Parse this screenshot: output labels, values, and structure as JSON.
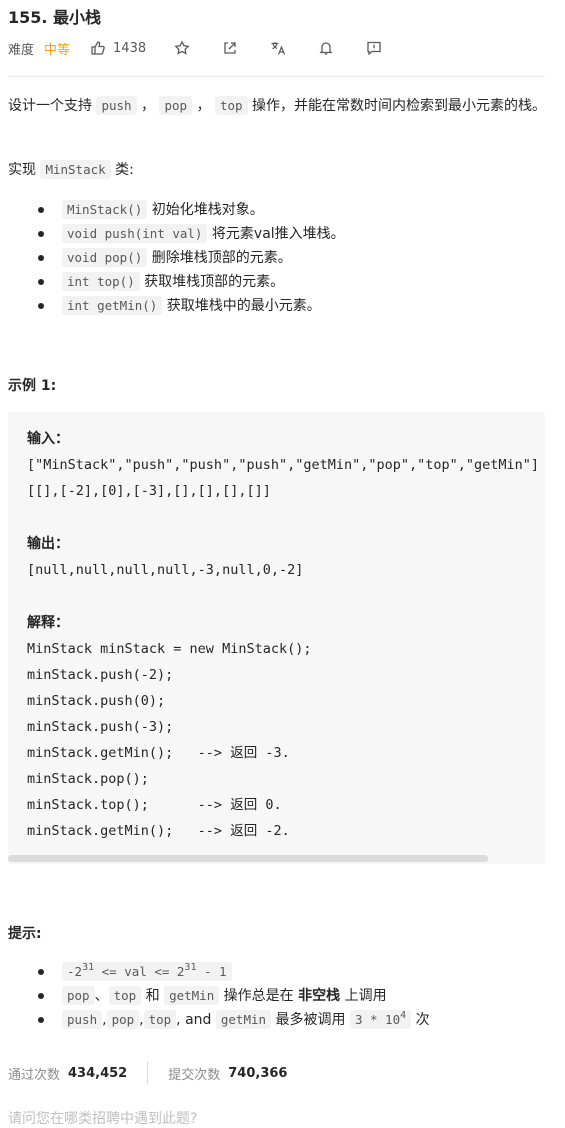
{
  "problem": {
    "title": "155. 最小栈"
  },
  "meta": {
    "difficulty_label": "难度",
    "difficulty": "中等",
    "likes": "1438"
  },
  "description": {
    "p1_a": "设计一个支持 ",
    "code_push": "push",
    "sep1": " ， ",
    "code_pop": "pop",
    "sep2": " ， ",
    "code_top": "top",
    "p1_b": " 操作，并能在常数时间内检索到最小元素的栈。",
    "p2_a": "实现 ",
    "code_minstack": "MinStack",
    "p2_b": " 类:"
  },
  "methods": [
    {
      "code": "MinStack()",
      "desc": " 初始化堆栈对象。"
    },
    {
      "code": "void push(int val)",
      "desc": " 将元素val推入堆栈。"
    },
    {
      "code": "void pop()",
      "desc": " 删除堆栈顶部的元素。"
    },
    {
      "code": "int top()",
      "desc": " 获取堆栈顶部的元素。"
    },
    {
      "code": "int getMin()",
      "desc": " 获取堆栈中的最小元素。"
    }
  ],
  "example": {
    "heading": "示例 1:",
    "input_label": "输入：",
    "input_line1": "[\"MinStack\",\"push\",\"push\",\"push\",\"getMin\",\"pop\",\"top\",\"getMin\"]",
    "input_line2": "[[],[-2],[0],[-3],[],[],[],[]]",
    "output_label": "输出：",
    "output_line": "[null,null,null,null,-3,null,0,-2]",
    "explain_label": "解释：",
    "explain_lines": [
      "MinStack minStack = new MinStack();",
      "minStack.push(-2);",
      "minStack.push(0);",
      "minStack.push(-3);",
      "minStack.getMin();   --> 返回 -3.",
      "minStack.pop();",
      "minStack.top();      --> 返回 0.",
      "minStack.getMin();   --> 返回 -2."
    ]
  },
  "hints": {
    "heading": "提示:",
    "h1_a": "-2",
    "h1_exp1": "31",
    "h1_b": " <= val <= 2",
    "h1_exp2": "31",
    "h1_c": " - 1",
    "h2_code1": "pop",
    "h2_sep": "、",
    "h2_code2": "top",
    "h2_and": " 和 ",
    "h2_code3": "getMin",
    "h2_a": " 操作总是在 ",
    "h2_bold": "非空栈",
    "h2_b": " 上调用",
    "h3_code1": "push",
    "h3_code2": "pop",
    "h3_code3": "top",
    "h3_and": ", and ",
    "h3_code4": "getMin",
    "h3_a": " 最多被调用 ",
    "h3_code5a": "3 * 10",
    "h3_exp": "4",
    "h3_b": " 次"
  },
  "stats": {
    "accepted_label": "通过次数",
    "accepted": "434,452",
    "submitted_label": "提交次数",
    "submitted": "740,366"
  },
  "footer_cut": "请问您在哪类招聘中遇到此题?"
}
